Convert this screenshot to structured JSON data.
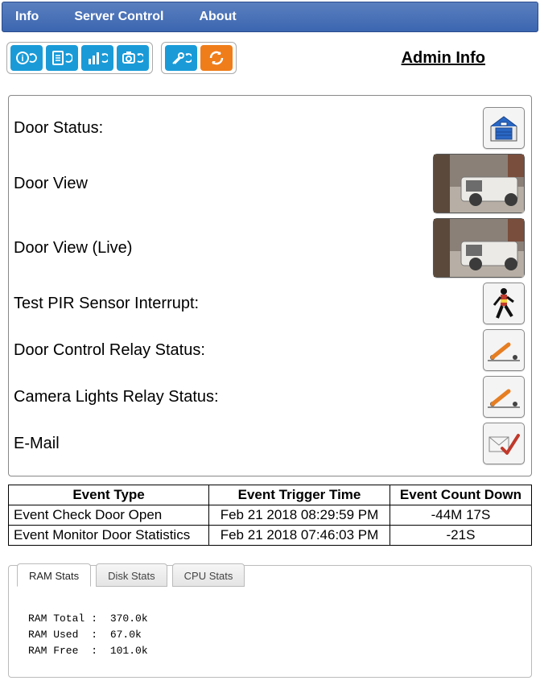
{
  "nav": {
    "info": "Info",
    "server": "Server Control",
    "about": "About"
  },
  "admin_link": "Admin Info",
  "rows": {
    "door_status": "Door Status:",
    "door_view": "Door View",
    "door_view_live": "Door View (Live)",
    "test_pir": "Test PIR Sensor Interrupt:",
    "door_relay": "Door Control Relay Status:",
    "camera_relay": "Camera Lights Relay Status:",
    "email": "E-Mail"
  },
  "events": {
    "headers": [
      "Event Type",
      "Event Trigger Time",
      "Event Count Down"
    ],
    "rows": [
      {
        "type": "Event Check Door Open",
        "time": "Feb 21 2018 08:29:59 PM",
        "count": "-44M 17S"
      },
      {
        "type": "Event Monitor Door Statistics",
        "time": "Feb 21 2018 07:46:03 PM",
        "count": "-21S"
      }
    ]
  },
  "stats": {
    "tabs": [
      "RAM Stats",
      "Disk Stats",
      "CPU Stats"
    ],
    "ram": [
      {
        "label": "RAM Total",
        "value": "370.0k"
      },
      {
        "label": "RAM Used",
        "value": "67.0k"
      },
      {
        "label": "RAM Free",
        "value": "101.0k"
      }
    ]
  }
}
